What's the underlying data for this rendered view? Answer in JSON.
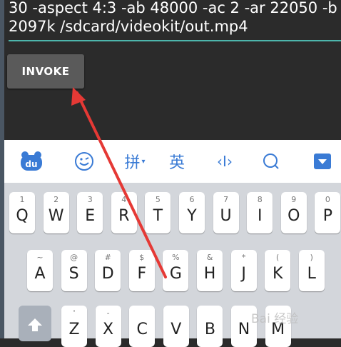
{
  "command": {
    "text": "30 -aspect 4:3 -ab 48000 -ac 2 -ar 22050 -b 2097k /sdcard/videokit/out.mp4"
  },
  "invoke_button": {
    "label": "INVOKE"
  },
  "ime_toolbar": {
    "logo_text": "du",
    "pinyin_label": "拼",
    "english_label": "英",
    "cursor_label": "‹I›"
  },
  "keyboard": {
    "row1": [
      {
        "hint": "1",
        "key": "Q"
      },
      {
        "hint": "2",
        "key": "W"
      },
      {
        "hint": "3",
        "key": "E"
      },
      {
        "hint": "4",
        "key": "R"
      },
      {
        "hint": "5",
        "key": "T"
      },
      {
        "hint": "6",
        "key": "Y"
      },
      {
        "hint": "7",
        "key": "U"
      },
      {
        "hint": "8",
        "key": "I"
      },
      {
        "hint": "9",
        "key": "O"
      },
      {
        "hint": "0",
        "key": "P"
      }
    ],
    "row2": [
      {
        "hint": "~",
        "key": "A"
      },
      {
        "hint": "@",
        "key": "S"
      },
      {
        "hint": "#",
        "key": "D"
      },
      {
        "hint": "$",
        "key": "F"
      },
      {
        "hint": "%",
        "key": "G"
      },
      {
        "hint": "&",
        "key": "H"
      },
      {
        "hint": "*",
        "key": "J"
      },
      {
        "hint": "(",
        "key": "K"
      },
      {
        "hint": ")",
        "key": "L"
      }
    ],
    "row3": [
      {
        "hint": "'",
        "key": "Z"
      },
      {
        "hint": "-",
        "key": "X"
      },
      {
        "hint": "",
        "key": "C"
      },
      {
        "hint": "",
        "key": "V"
      },
      {
        "hint": "",
        "key": "B"
      },
      {
        "hint": "",
        "key": "N"
      },
      {
        "hint": "",
        "key": "M"
      }
    ]
  },
  "watermark": {
    "text": "Bai 经验"
  },
  "colors": {
    "accent": "#4db6ac",
    "arrow": "#e53935",
    "ime_blue": "#3a7bd5"
  }
}
